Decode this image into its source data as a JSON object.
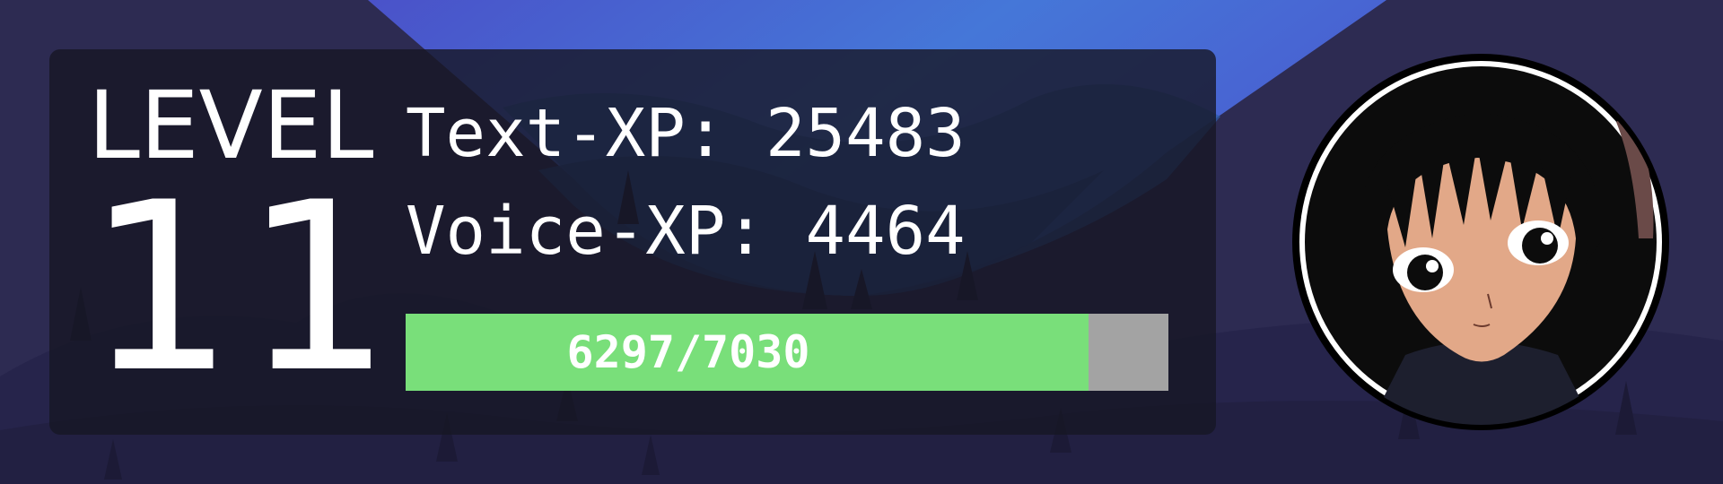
{
  "rank_card": {
    "level_label": "LEVEL",
    "level_number": "11",
    "text_xp_line": "Text-XP: 25483",
    "voice_xp_line": "Voice-XP: 4464",
    "progress": {
      "label": "6297/7030",
      "current": 6297,
      "total": 7030
    }
  },
  "avatar": {
    "icon": "anime-avatar-icon"
  },
  "colors": {
    "background": "#2d2b52",
    "sky_glow": "#4a6fd8",
    "card": "#161624",
    "bar_fill": "#79df7a",
    "bar_track": "#a3a3a3",
    "text": "#ffffff"
  }
}
